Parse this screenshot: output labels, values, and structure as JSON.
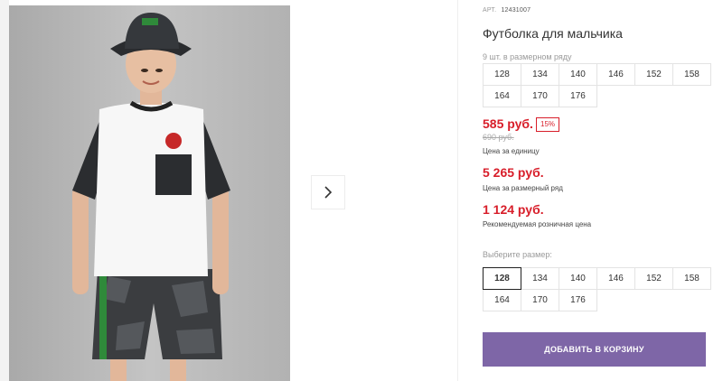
{
  "gallery": {
    "next_icon": "chevron-right-icon"
  },
  "product": {
    "article_label": "АРТ.",
    "article_number": "12431007",
    "title": "Футболка для мальчика",
    "size_count_text": "9 шт. в размерном ряду",
    "size_range": [
      "128",
      "134",
      "140",
      "146",
      "152",
      "158",
      "164",
      "170",
      "176"
    ],
    "price": "585 руб.",
    "discount": "15%",
    "old_price": "690 руб.",
    "price_per_unit_label": "Цена за единицу",
    "range_price": "5 265 руб.",
    "range_price_label": "Цена за размерный ряд",
    "retail_price": "1 124 руб.",
    "retail_price_label": "Рекомендуемая розничная цена",
    "choose_size_label": "Выберите размер:",
    "size_options": [
      "128",
      "134",
      "140",
      "146",
      "152",
      "158",
      "164",
      "170",
      "176"
    ],
    "selected_size": "128",
    "add_to_cart_label": "ДОБАВИТЬ В КОРЗИНУ"
  },
  "colors": {
    "price_red": "#d81e2a",
    "button_purple": "#7e66a7"
  }
}
